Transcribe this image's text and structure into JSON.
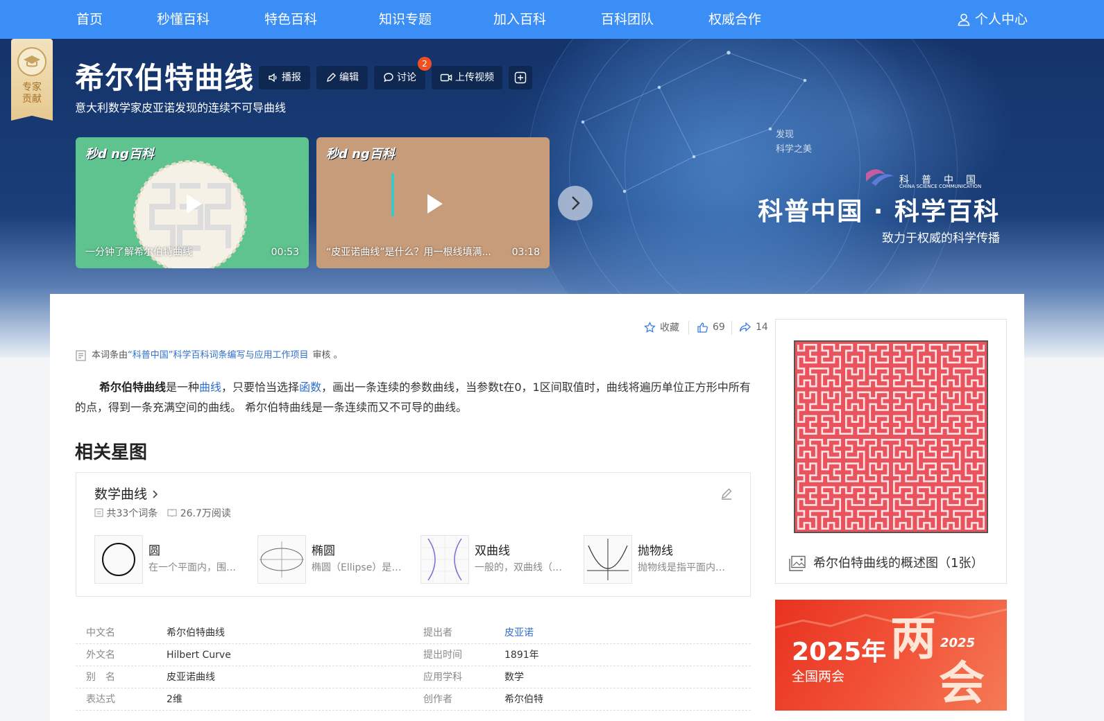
{
  "nav": {
    "items": [
      "首页",
      "秒懂百科",
      "特色百科",
      "知识专题",
      "加入百科",
      "百科团队",
      "权威合作"
    ],
    "user": "个人中心"
  },
  "badge": {
    "label_line1": "专家",
    "label_line2": "贡献"
  },
  "entry": {
    "title": "希尔伯特曲线",
    "subtitle": "意大利数学家皮亚诺发现的连续不可导曲线",
    "actions": {
      "broadcast": "播报",
      "edit": "编辑",
      "discuss": "讨论",
      "upload_video": "上传视频"
    },
    "discuss_count": "2"
  },
  "videos": [
    {
      "logo": "秒d ng百科",
      "caption": "一分钟了解希尔伯特曲线",
      "duration": "00:53",
      "bg": "#5ec38f"
    },
    {
      "logo": "秒d ng百科",
      "caption": "“皮亚诺曲线”是什么？用一根线填满...",
      "duration": "03:18",
      "bg": "#c79c7a"
    }
  ],
  "promo": {
    "small_line1": "发现",
    "small_line2": "科学之美",
    "org": "科普中国",
    "org_en": "CHINA SCIENCE COMMUNICATION",
    "title": "科普中国 · 科学百科",
    "subtitle": "致力于权威的科学传播"
  },
  "meta": {
    "collect": "收藏",
    "likes": "69",
    "shares": "14"
  },
  "review": {
    "prefix": "本词条由",
    "link": "“科普中国”科学百科词条编写与应用工作项目",
    "suffix": "审核 。"
  },
  "summary": {
    "term": "希尔伯特曲线",
    "t1": "是一种",
    "link1": "曲线",
    "t2": "，只要恰当选择",
    "link2": "函数",
    "t3": "，画出一条连续的参数曲线，当参数t在0，1区间取值时，曲线将遍历单位正方形中所有的点，得到一条充满空间的曲线。 希尔伯特曲线是一条连续而又不可导的曲线。"
  },
  "related": {
    "section_title": "相关星图",
    "name": "数学曲线",
    "entries": "共33个词条",
    "reads": "26.7万阅读",
    "items": [
      {
        "name": "圆",
        "desc": "在一个平面内，围绕一个点..."
      },
      {
        "name": "椭圆",
        "desc": "椭圆（Ellipse）是平面内..."
      },
      {
        "name": "双曲线",
        "desc": "一般的，双曲线（希腊语..."
      },
      {
        "name": "抛物线",
        "desc": "抛物线是指平面内到一个定..."
      }
    ]
  },
  "info": [
    {
      "k1": "中文名",
      "v1": "希尔伯特曲线",
      "k2": "提出者",
      "v2": "皮亚诺"
    },
    {
      "k1": "外文名",
      "v1": "Hilbert Curve",
      "k2": "提出时间",
      "v2": "1891年"
    },
    {
      "k1": "别　名",
      "v1": "皮亚诺曲线",
      "k2": "应用学科",
      "v2": "数学"
    },
    {
      "k1": "表达式",
      "v1": "2维",
      "k2": "创作者",
      "v2": "希尔伯特"
    }
  ],
  "figure": {
    "caption": "希尔伯特曲线的概述图（1张）"
  },
  "ad": {
    "year": "2025年",
    "sub": "全国两会",
    "big1": "两",
    "big2": "会",
    "tag": "2025"
  },
  "colors": {
    "nav_bg": "#3b8ef5",
    "link": "#2f6fcc",
    "hilbert": "#e8535e"
  }
}
